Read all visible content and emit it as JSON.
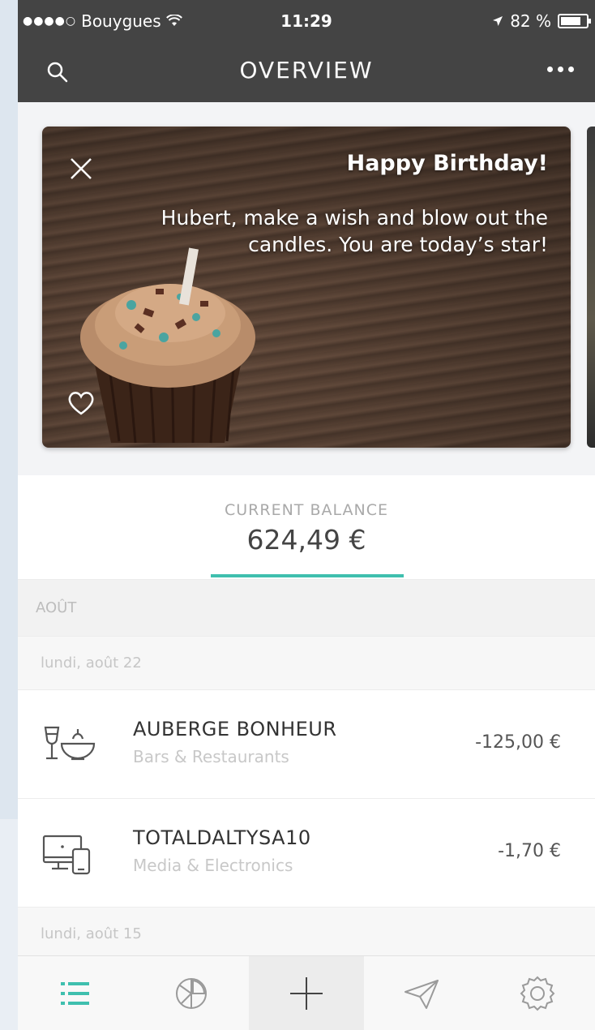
{
  "status_bar": {
    "carrier": "Bouygues",
    "time": "11:29",
    "battery": "82 %",
    "battery_level": 0.82
  },
  "nav": {
    "title": "OVERVIEW"
  },
  "card": {
    "heading": "Happy Birthday!",
    "message": "Hubert, make a wish and blow out the candles. You are today’s star!"
  },
  "balance": {
    "label": "CURRENT BALANCE",
    "amount": "624,49 €"
  },
  "month": "AOÛT",
  "days": [
    {
      "label": "lundi, août 22"
    },
    {
      "label": "lundi, août 15"
    }
  ],
  "transactions": [
    {
      "name": "AUBERGE BONHEUR",
      "category": "Bars & Restaurants",
      "amount": "-125,00 €",
      "icon": "restaurant-icon"
    },
    {
      "name": "TOTALDALTYSA10",
      "category": "Media & Electronics",
      "amount": "-1,70 €",
      "icon": "electronics-icon"
    }
  ],
  "tabs": [
    {
      "icon": "list-icon"
    },
    {
      "icon": "chart-pie-icon"
    },
    {
      "icon": "plus-icon"
    },
    {
      "icon": "send-icon"
    },
    {
      "icon": "settings-icon"
    }
  ],
  "colors": {
    "accent": "#3fbfae",
    "header": "#444444"
  }
}
